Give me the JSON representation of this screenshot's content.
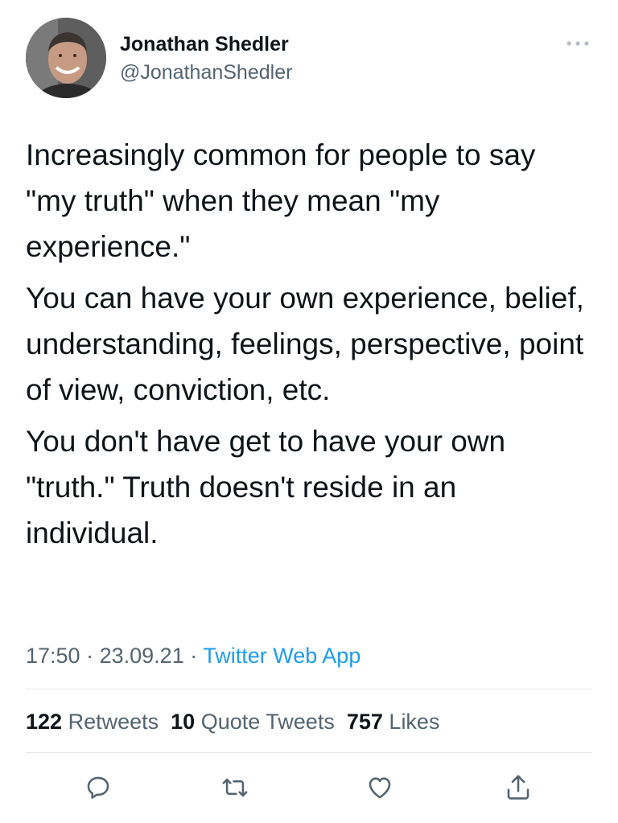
{
  "author": {
    "name": "Jonathan Shedler",
    "handle": "@JonathanShedler"
  },
  "tweet": {
    "paragraphs": [
      "Increasingly common for people to say \"my truth\" when they mean \"my experience.\"",
      "You can have your own experience, belief, understanding, feelings, perspective, point of view, conviction, etc.",
      "You don't have get to have your own \"truth.\" Truth doesn't reside in an individual."
    ]
  },
  "meta": {
    "time": "17:50",
    "separator": "·",
    "date": "23.09.21",
    "source": "Twitter Web App"
  },
  "stats": {
    "retweets_count": "122",
    "retweets_label": "Retweets",
    "quotes_count": "10",
    "quotes_label": "Quote Tweets",
    "likes_count": "757",
    "likes_label": "Likes"
  },
  "icons": {
    "more": "more-horizontal-icon",
    "reply": "reply-icon",
    "retweet": "retweet-icon",
    "like": "heart-icon",
    "share": "share-icon"
  },
  "colors": {
    "text": "#0f1419",
    "secondary": "#536471",
    "link": "#1d9bf0",
    "divider": "#e4e8eb"
  }
}
